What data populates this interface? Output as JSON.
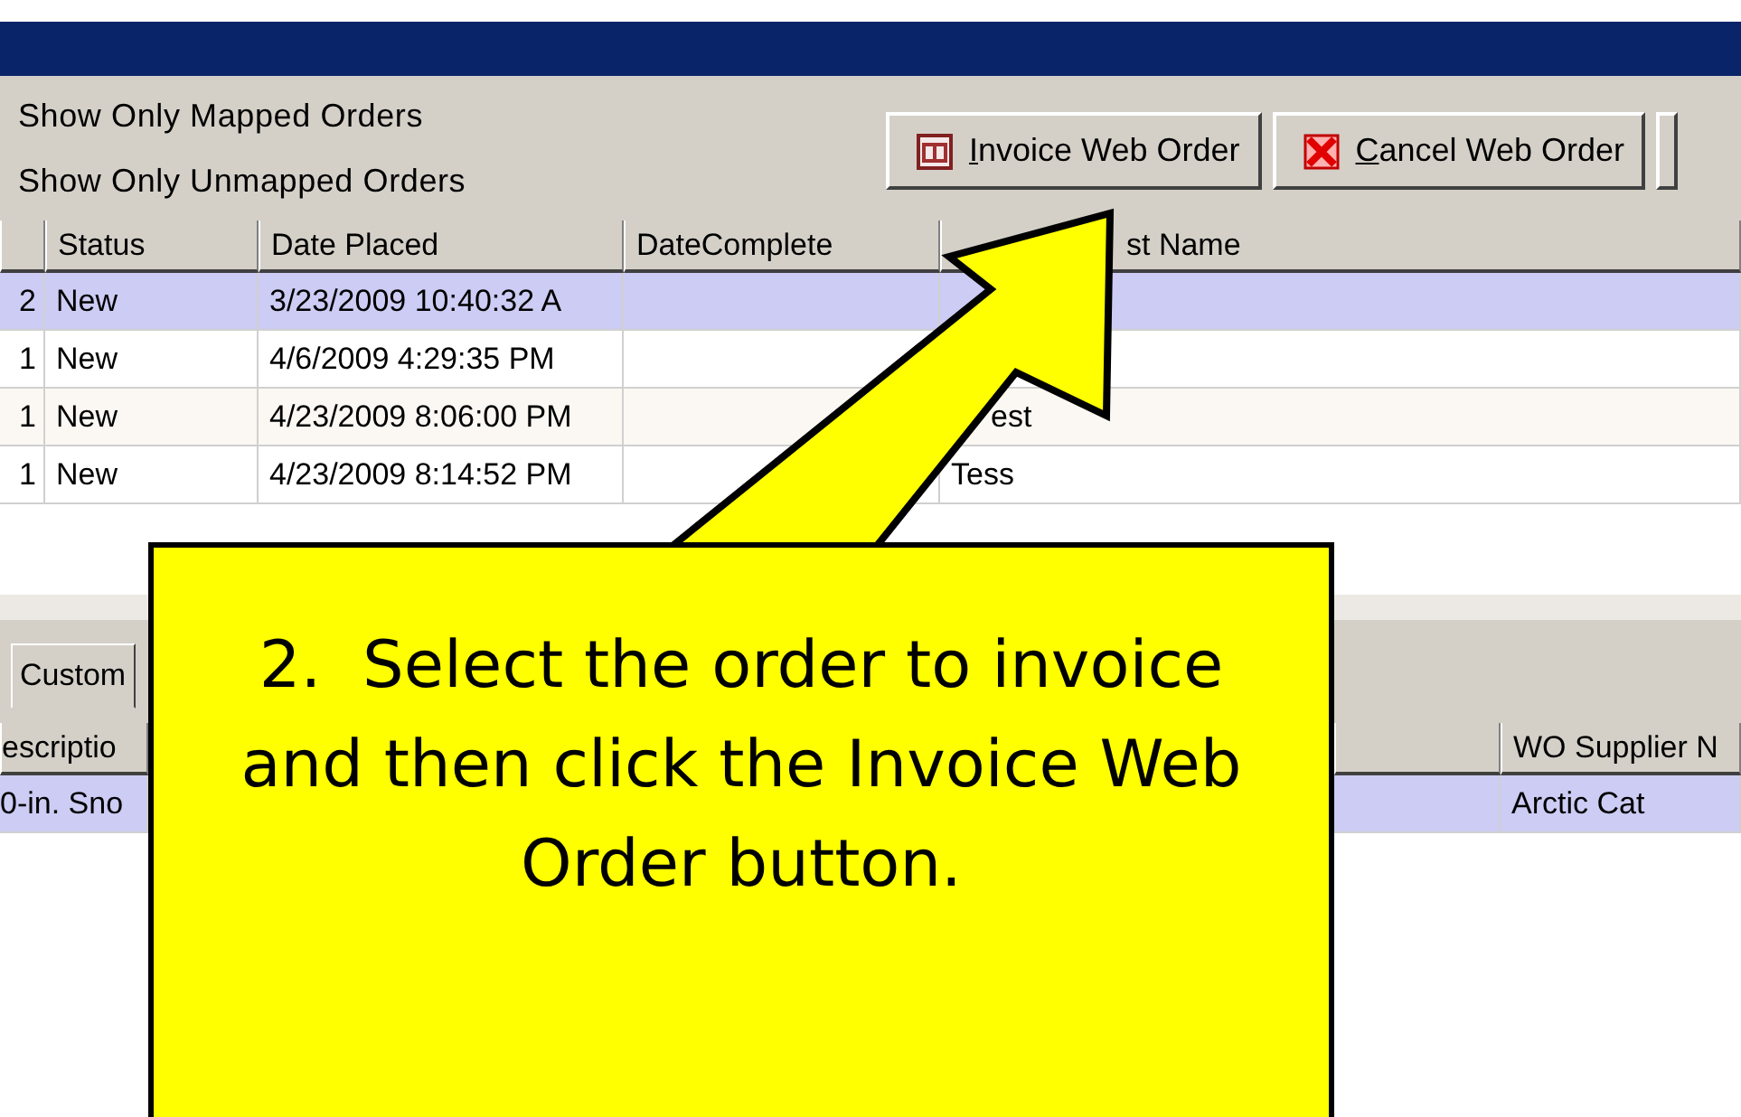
{
  "filters": [
    {
      "label": "Show Only Mapped Orders"
    },
    {
      "label": "Show Only Unmapped Orders"
    }
  ],
  "toolbar_buttons": [
    {
      "kind": "invoice",
      "label": "Invoice Web Order"
    },
    {
      "kind": "cancel",
      "label": "Cancel Web Order"
    }
  ],
  "orders": {
    "columns": [
      "",
      "Status",
      "Date Placed",
      "DateComplete",
      "st Name"
    ],
    "rows": [
      {
        "selected": true,
        "cells": [
          "2",
          "New",
          "3/23/2009 10:40:32 A",
          "",
          ""
        ]
      },
      {
        "selected": false,
        "cells": [
          "1",
          "New",
          "4/6/2009 4:29:35 PM",
          "",
          ""
        ]
      },
      {
        "selected": false,
        "cells": [
          "1",
          "New",
          "4/23/2009 8:06:00 PM",
          "",
          "est"
        ]
      },
      {
        "selected": false,
        "cells": [
          "1",
          "New",
          "4/23/2009 8:14:52 PM",
          "",
          "Tess"
        ]
      }
    ]
  },
  "detail_tab": "Custom",
  "details": {
    "columns": [
      "escriptio",
      "WO Supplier N"
    ],
    "rows": [
      {
        "selected": true,
        "cells": [
          "0-in. Sno",
          "Arctic Cat"
        ]
      }
    ]
  },
  "callout": {
    "text": "2.  Select the order to invoice and then click the Invoice Web Order button."
  }
}
